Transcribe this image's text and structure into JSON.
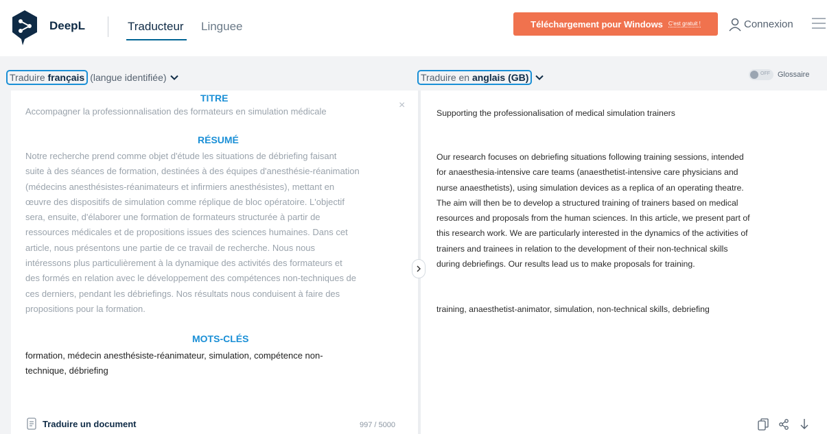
{
  "header": {
    "brand": "DeepL",
    "tabs": [
      {
        "label": "Traducteur"
      },
      {
        "label": "Linguee"
      }
    ],
    "download_label": "Téléchargement pour Windows",
    "download_badge": "C'est gratuit !",
    "login_label": "Connexion"
  },
  "source_lang": {
    "prefix": "Traduire",
    "language": "français",
    "detected": "(langue identifiée)"
  },
  "target_lang": {
    "prefix": "Traduire en",
    "language": "anglais (GB)"
  },
  "glossary": {
    "toggle_state": "OFF",
    "label": "Glossaire"
  },
  "source": {
    "title_heading": "TITRE",
    "title_text": "Accompagner la professionnalisation des formateurs en simulation médicale",
    "abstract_heading": "RÉSUMÉ",
    "abstract_lines": [
      "Notre recherche prend comme objet d'étude les situations de débriefing faisant",
      "suite à des séances de formation, destinées à des équipes d'anesthésie-réanimation",
      "(médecins anesthésistes-réanimateurs et infirmiers anesthésistes), mettant en",
      "œuvre des dispositifs de simulation comme réplique de bloc opératoire. L'objectif",
      "sera, ensuite, d'élaborer une formation de formateurs structurée à partir de",
      "ressources médicales et de propositions issues des sciences humaines. Dans cet",
      "article, nous présentons une partie de ce travail de recherche. Nous nous",
      "intéressons plus particulièrement à la dynamique des activités des formateurs et",
      "des formés en relation avec le développement des compétences non-techniques de",
      "ces derniers, pendant les débriefings. Nos résultats nous conduisent à faire des",
      "propositions pour la formation."
    ],
    "keywords_heading": "MOTS-CLÉS",
    "keywords_lines": [
      "formation, médecin anesthésiste-réanimateur, simulation, compétence non-",
      "technique, débriefing"
    ],
    "document_label": "Traduire un document",
    "char_count": "997 / 5000"
  },
  "target": {
    "title_text": "Supporting the professionalisation of medical simulation trainers",
    "abstract_lines": [
      "Our research focuses on debriefing situations following training sessions, intended",
      "for anaesthesia-intensive care teams (anaesthetist-intensive care physicians and",
      "nurse anaesthetists), using simulation devices as a replica of an operating theatre.",
      "The aim will then be to develop a structured training of trainers based on medical",
      "resources and proposals from the human sciences. In this article, we present part of",
      "this research work. We are particularly interested in the dynamics of the activities of",
      "trainers and trainees in relation to the development of their non-technical skills",
      "during debriefings. Our results lead us to make proposals for training."
    ],
    "keywords_text": "training, anaesthetist-animator, simulation, non-technical skills, debriefing"
  },
  "colors": {
    "accent_blue": "#1a8fd6",
    "download_orange": "#f0724e",
    "brand_navy": "#0f2b46"
  }
}
